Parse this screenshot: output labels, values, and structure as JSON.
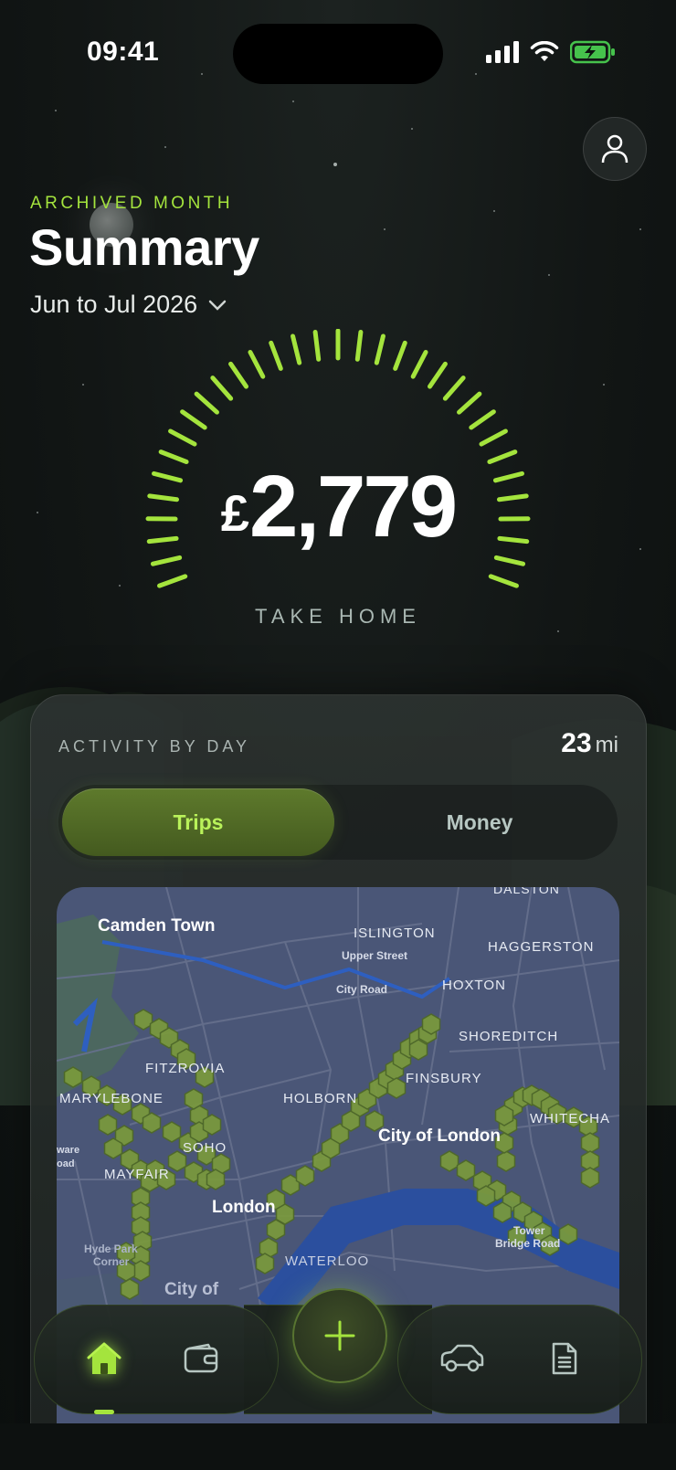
{
  "status_bar": {
    "time": "09:41"
  },
  "header": {
    "eyebrow": "ARCHIVED MONTH",
    "title": "Summary",
    "period": "Jun to Jul 2026"
  },
  "gauge": {
    "currency": "£",
    "amount": "2,779",
    "label": "TAKE HOME"
  },
  "activity": {
    "title": "ACTIVITY BY DAY",
    "distance_value": "23",
    "distance_unit": "mi",
    "tabs": [
      {
        "label": "Trips",
        "active": true
      },
      {
        "label": "Money",
        "active": false
      }
    ],
    "map_labels": [
      "Camden Town",
      "ISLINGTON",
      "Upper Street",
      "City Road",
      "DALSTON",
      "HAGGERSTON",
      "HOXTON",
      "SHOREDITCH",
      "FINSBURY",
      "FITZROVIA",
      "MARYLEBONE",
      "HOLBORN",
      "City of London",
      "WHITECHA",
      "SOHO",
      "ware",
      "oad",
      "MAYFAIR",
      "London",
      "Tower",
      "Bridge Road",
      "Hyde Park",
      "Corner",
      "WATERLOO",
      "City of"
    ]
  },
  "nav": {
    "items": [
      "home-icon",
      "wallet-icon",
      "add-icon",
      "car-icon",
      "document-icon"
    ],
    "active": "home"
  },
  "colors": {
    "accent": "#a4e43d",
    "background": "#121615",
    "card": "#2a302e",
    "map": "#4a5677",
    "hex_fill": "#7a9a3c"
  }
}
